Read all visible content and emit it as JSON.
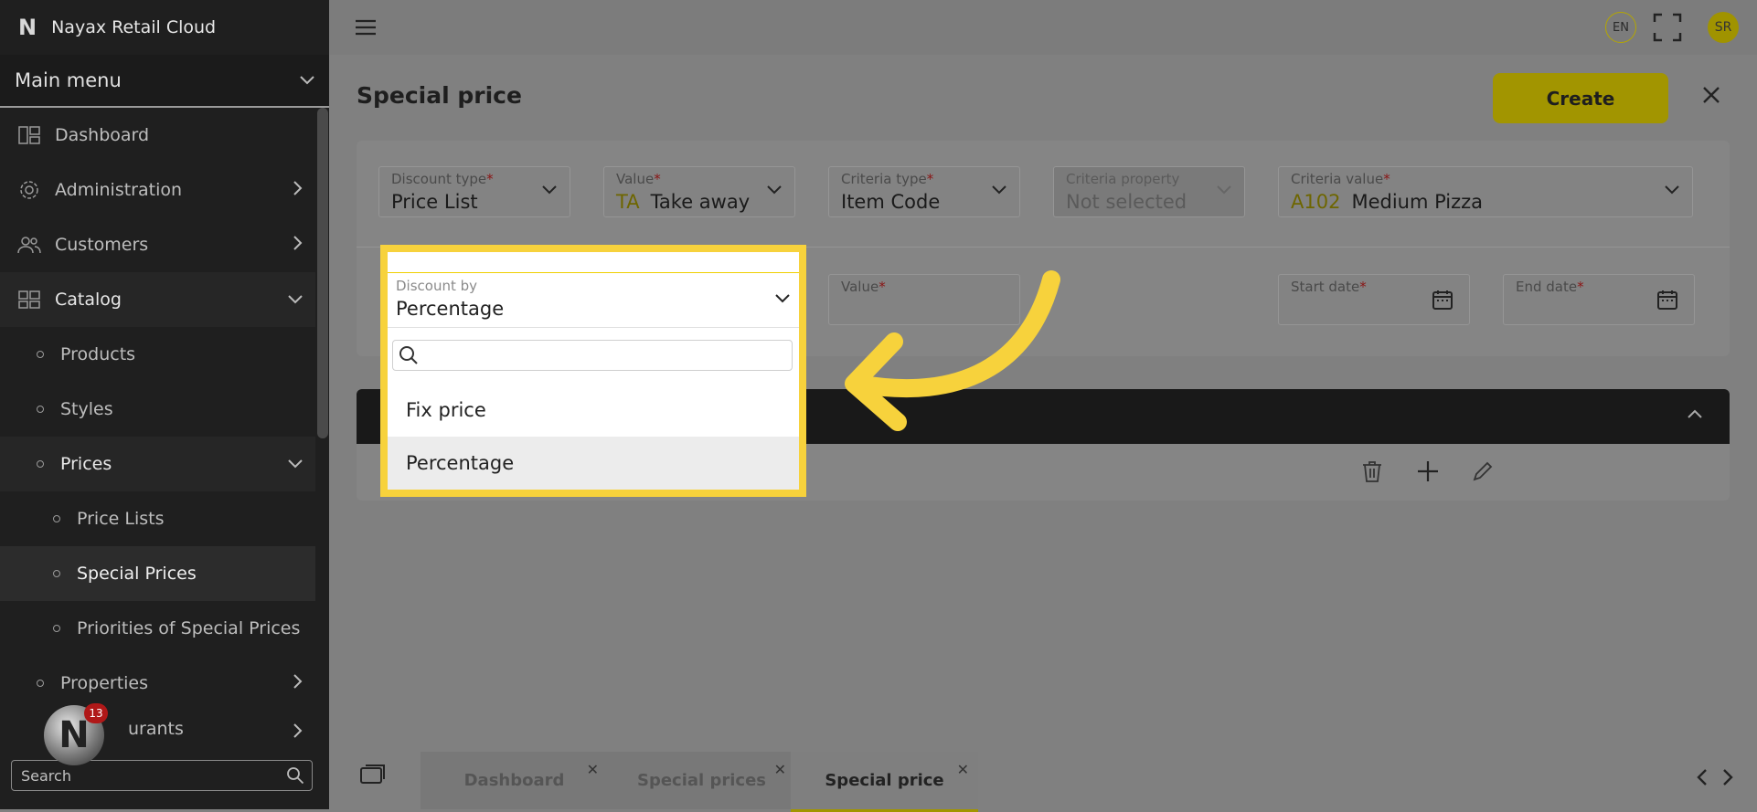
{
  "app": {
    "title": "Nayax Retail Cloud",
    "logo": "N"
  },
  "sidebar": {
    "menu_label": "Main menu",
    "items": [
      {
        "label": "Dashboard",
        "icon": "dashboard-icon"
      },
      {
        "label": "Administration",
        "icon": "gear-icon"
      },
      {
        "label": "Customers",
        "icon": "users-icon"
      },
      {
        "label": "Catalog",
        "icon": "grid-icon"
      },
      {
        "label": "Products"
      },
      {
        "label": "Styles"
      },
      {
        "label": "Prices"
      },
      {
        "label": "Price Lists"
      },
      {
        "label": "Special Prices"
      },
      {
        "label": "Priorities of Special Prices"
      },
      {
        "label": "Properties"
      },
      {
        "label": "urants"
      }
    ],
    "search_placeholder": "Search",
    "notification_count": "13"
  },
  "topbar": {
    "lang": "EN",
    "user_initials": "SR"
  },
  "page": {
    "title": "Special price",
    "create_label": "Create",
    "fields": {
      "discount_type": {
        "label": "Discount type",
        "value": "Price List"
      },
      "value": {
        "label": "Value",
        "code": "TA",
        "value": "Take away"
      },
      "criteria_type": {
        "label": "Criteria type",
        "value": "Item Code"
      },
      "criteria_property": {
        "label": "Criteria property",
        "value": "Not selected"
      },
      "criteria_value": {
        "label": "Criteria value",
        "code": "A102",
        "value": "Medium Pizza"
      },
      "value2": {
        "label": "Value"
      },
      "start_date": {
        "label": "Start date"
      },
      "end_date": {
        "label": "End date"
      }
    },
    "required_mark": "*"
  },
  "dropdown": {
    "label": "Discount by",
    "value": "Percentage",
    "options": [
      "Fix price",
      "Percentage"
    ]
  },
  "tabs": [
    {
      "label": "Dashboard"
    },
    {
      "label": "Special prices"
    },
    {
      "label": "Special price"
    }
  ],
  "colors": {
    "accent": "#a29500",
    "highlight": "#f7d23c",
    "sidebar": "#1f1f1f"
  }
}
